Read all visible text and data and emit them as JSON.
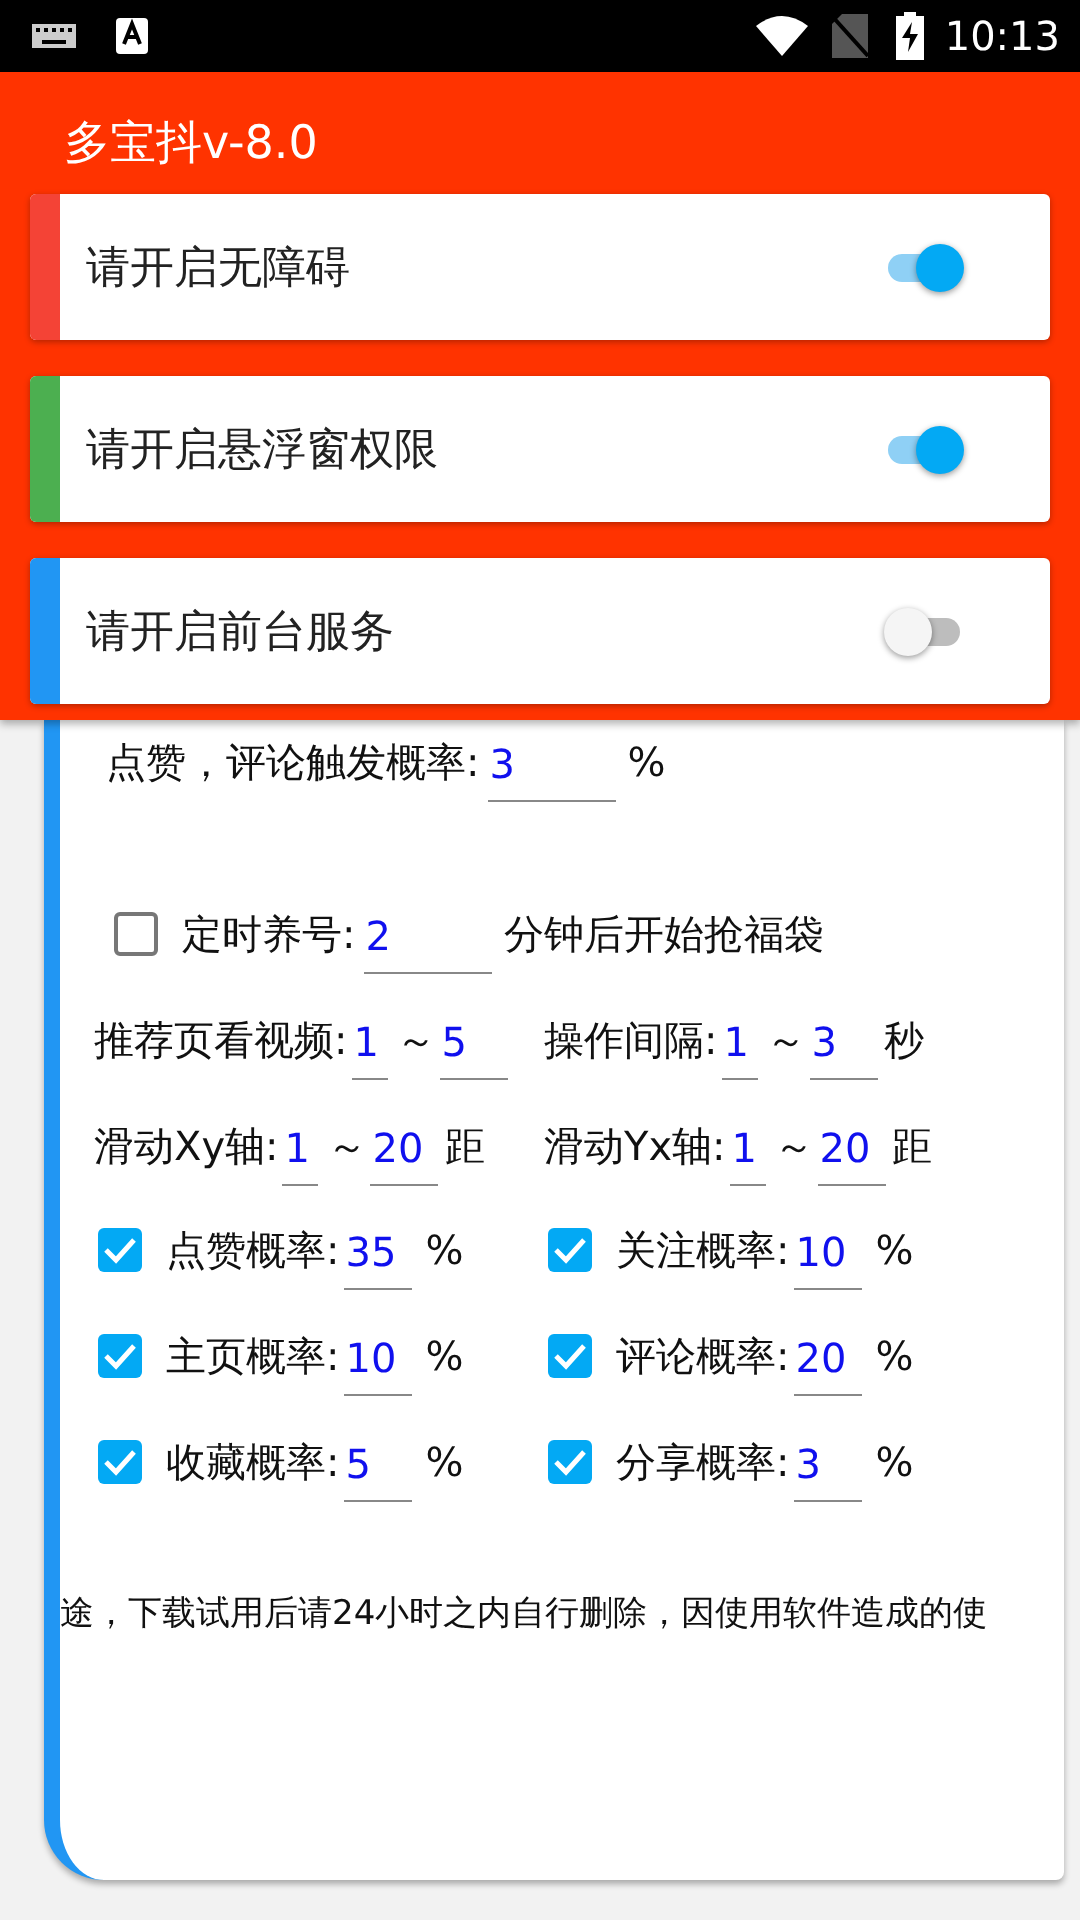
{
  "status_bar": {
    "time": "10:13"
  },
  "app_bar": {
    "title": "多宝抖v-8.0"
  },
  "permissions": [
    {
      "label": "请开启无障碍",
      "color": "#f44336",
      "on": true
    },
    {
      "label": "请开启悬浮窗权限",
      "color": "#4caf50",
      "on": true
    },
    {
      "label": "请开启前台服务",
      "color": "#2196f3",
      "on": false
    }
  ],
  "settings": {
    "trigger_rate": {
      "label": "点赞，评论触发概率:",
      "value": "3",
      "unit": "%"
    },
    "timer": {
      "checked": false,
      "label": "定时养号:",
      "value": "2",
      "suffix": "分钟后开始抢福袋"
    },
    "range_rows": [
      [
        {
          "label": "推荐页看视频:",
          "from": "1",
          "sep": "～",
          "to": "5"
        },
        {
          "label": "操作间隔:",
          "from": "1",
          "sep": "～",
          "to": "3",
          "unit": "秒"
        }
      ],
      [
        {
          "label": "滑动Xy轴:",
          "from": "1",
          "sep": "～",
          "to": "20",
          "unit": "距"
        },
        {
          "label": "滑动Yx轴:",
          "from": "1",
          "sep": "～",
          "to": "20",
          "unit": "距"
        }
      ]
    ],
    "rates": [
      {
        "label": "点赞概率:",
        "value": "35",
        "unit": "%",
        "checked": true
      },
      {
        "label": "关注概率:",
        "value": "10",
        "unit": "%",
        "checked": true
      },
      {
        "label": "主页概率:",
        "value": "10",
        "unit": "%",
        "checked": true
      },
      {
        "label": "评论概率:",
        "value": "20",
        "unit": "%",
        "checked": true
      },
      {
        "label": "收藏概率:",
        "value": "5",
        "unit": "%",
        "checked": true
      },
      {
        "label": "分享概率:",
        "value": "3",
        "unit": "%",
        "checked": true
      }
    ],
    "notice": "途，下载试用后请24小时之内自行删除，因使用软件造成的使"
  }
}
